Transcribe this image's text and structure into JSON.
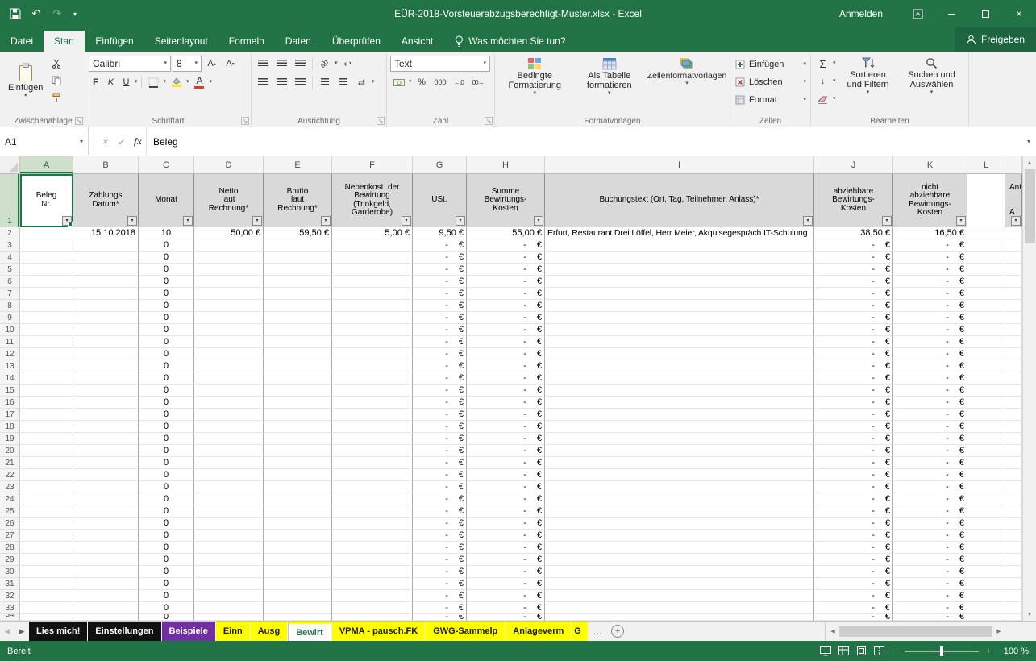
{
  "colors": {
    "excel_green": "#217346",
    "tab_yellow": "#ffff00",
    "tab_purple": "#7030a0",
    "tab_black": "#111111",
    "header_fill": "#d9d9d9"
  },
  "titlebar": {
    "title": "EÜR-2018-Vorsteuerabzugsberechtigt-Muster.xlsx  -  Excel",
    "signin": "Anmelden"
  },
  "ribbon": {
    "tabs": [
      {
        "label": "Datei",
        "file": true
      },
      {
        "label": "Start",
        "active": true
      },
      {
        "label": "Einfügen"
      },
      {
        "label": "Seitenlayout"
      },
      {
        "label": "Formeln"
      },
      {
        "label": "Daten"
      },
      {
        "label": "Überprüfen"
      },
      {
        "label": "Ansicht"
      }
    ],
    "tellme": "Was möchten Sie tun?",
    "share": "Freigeben",
    "clipboard": {
      "label": "Zwischenablage",
      "paste": "Einfügen"
    },
    "font": {
      "label": "Schriftart",
      "font_name": "Calibri",
      "font_size": "8",
      "bold": "F",
      "italic": "K",
      "underline": "U"
    },
    "alignment": {
      "label": "Ausrichtung"
    },
    "number": {
      "label": "Zahl",
      "format": "Text",
      "percent": "%",
      "thousands": "000"
    },
    "styles": {
      "label": "Formatvorlagen",
      "conditional": "Bedingte Formatierung",
      "as_table": "Als Tabelle formatieren",
      "cell_styles": "Zellenformatvorlagen"
    },
    "cells": {
      "label": "Zellen",
      "insert": "Einfügen",
      "delete": "Löschen",
      "format": "Format"
    },
    "editing": {
      "label": "Bearbeiten",
      "autosum": "Σ",
      "sort": "Sortieren und Filtern",
      "find": "Suchen und Auswählen"
    }
  },
  "formula_bar": {
    "name_box": "A1",
    "fx": "fx",
    "value": "Beleg"
  },
  "grid": {
    "column_letters": [
      "A",
      "B",
      "C",
      "D",
      "E",
      "F",
      "G",
      "H",
      "I",
      "J",
      "K",
      "L",
      ""
    ],
    "selected_cell": "A1",
    "headers": [
      {
        "col": "A",
        "text": "Beleg\nNr.",
        "filter": true,
        "selected": true
      },
      {
        "col": "B",
        "text": "Zahlungs\nDatum*",
        "filter": true
      },
      {
        "col": "C",
        "text": "Monat",
        "filter": true
      },
      {
        "col": "D",
        "text": "Netto\nlaut\nRechnung*",
        "filter": true
      },
      {
        "col": "E",
        "text": "Brutto\nlaut\nRechnung*",
        "filter": true
      },
      {
        "col": "F",
        "text": "Nebenkost. der\nBewirtung\n(Trinkgeld,\nGarderobe)",
        "filter": true
      },
      {
        "col": "G",
        "text": "USt.",
        "filter": true
      },
      {
        "col": "H",
        "text": "Summe\nBewirtungs-\nKosten",
        "filter": true
      },
      {
        "col": "I",
        "text": "Buchungstext (Ort, Tag, Teilnehmer, Anlass)*",
        "filter": true
      },
      {
        "col": "J",
        "text": "abziehbare\nBewirtungs-\nKosten",
        "filter": true
      },
      {
        "col": "K",
        "text": "nicht\nabziehbare\nBewirtungs-\nKosten",
        "filter": true
      },
      {
        "col": "L",
        "text": "",
        "filter": false,
        "blank": true
      },
      {
        "col": "M",
        "text": "Ant\n\n\nA",
        "filter": true,
        "partial": true
      }
    ],
    "row2": {
      "B": "15.10.2018",
      "C": "10",
      "D": "50,00 €",
      "E": "59,50 €",
      "F": "5,00 €",
      "G": "9,50 €",
      "H": "55,00 €",
      "I": "Erfurt, Restaurant Drei Löffel, Herr Meier, Akquisegespräch IT-Schulung",
      "J": "38,50 €",
      "K": "16,50 €"
    },
    "empty_row": {
      "C": "0",
      "G": "- €",
      "H": "- €",
      "J": "- €",
      "K": "- €"
    },
    "first_data_row": 2,
    "last_full_row": 33,
    "partial_row": 34
  },
  "sheet_tabs": {
    "tabs": [
      {
        "label": "Lies mich!",
        "bg": "#111111",
        "fg": "#ffffff"
      },
      {
        "label": "Einstellungen",
        "bg": "#111111",
        "fg": "#ffffff"
      },
      {
        "label": "Beispiele",
        "bg": "#7030a0",
        "fg": "#ffffff"
      },
      {
        "label": "Einn",
        "bg": "#ffff00",
        "fg": "#1a1a00"
      },
      {
        "label": "Ausg",
        "bg": "#ffff00",
        "fg": "#1a1a00"
      },
      {
        "label": "Bewirt",
        "bg": "#ffffff",
        "fg": "#217346",
        "active": true,
        "color_strip": "#ffff00"
      },
      {
        "label": "VPMA - pausch.FK",
        "bg": "#ffff00",
        "fg": "#1a1a00"
      },
      {
        "label": "GWG-Sammelp",
        "bg": "#ffff00",
        "fg": "#1a1a00"
      },
      {
        "label": "Anlageverm",
        "bg": "#ffff00",
        "fg": "#1a1a00"
      },
      {
        "label": "G",
        "bg": "#ffff00",
        "fg": "#1a1a00",
        "partial": true
      }
    ],
    "overflow": "…"
  },
  "status_bar": {
    "ready": "Bereit",
    "zoom": "100 %"
  }
}
